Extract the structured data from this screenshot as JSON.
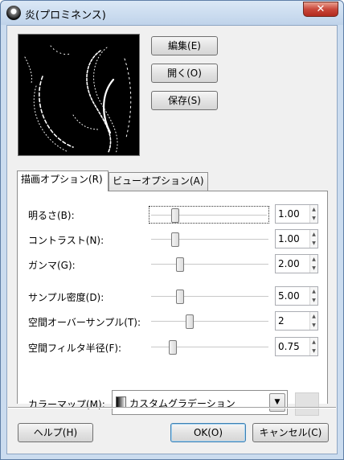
{
  "window": {
    "title": "炎(プロミネンス)",
    "close_glyph": "✕"
  },
  "preview_buttons": {
    "edit": "編集(E)",
    "open": "開く(O)",
    "save": "保存(S)"
  },
  "tabs": [
    {
      "label": "描画オプション(R)",
      "active": true
    },
    {
      "label": "ビューオプション(A)",
      "active": false
    }
  ],
  "parameters": [
    {
      "label": "明るさ(B):",
      "value": "1.00",
      "slider_fraction": 0.2
    },
    {
      "label": "コントラスト(N):",
      "value": "1.00",
      "slider_fraction": 0.2
    },
    {
      "label": "ガンマ(G):",
      "value": "2.00",
      "slider_fraction": 0.25
    },
    {
      "label": "サンプル密度(D):",
      "value": "5.00",
      "slider_fraction": 0.25
    },
    {
      "label": "空間オーバーサンプル(T):",
      "value": "2",
      "slider_fraction": 0.33
    },
    {
      "label": "空間フィルタ半径(F):",
      "value": "0.75",
      "slider_fraction": 0.18
    }
  ],
  "colormap": {
    "label": "カラーマップ(M):",
    "selected": "カスタムグラデーション"
  },
  "footer": {
    "help": "ヘルプ(H)",
    "ok": "OK(O)",
    "cancel": "キャンセル(C)"
  },
  "colors": {
    "frame": "#cbdcef",
    "client": "#f0f0f0",
    "close": "#c9473a"
  }
}
